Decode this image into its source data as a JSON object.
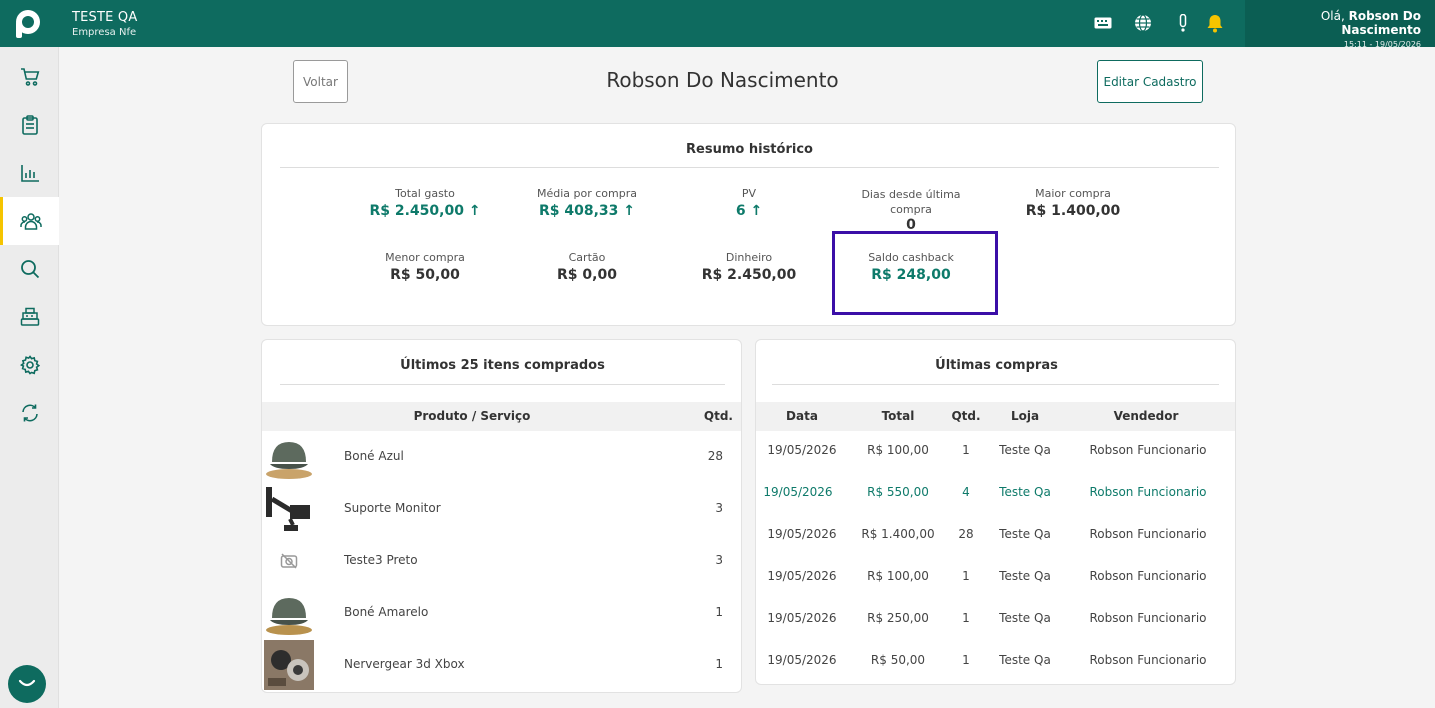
{
  "header": {
    "company_name": "TESTE QA",
    "company_sub": "Empresa Nfe",
    "greeting_prefix": "Olá,",
    "user_name": "Robson Do Nascimento",
    "datetime": "15:11 - 19/05/2026"
  },
  "actions": {
    "back_label": "Voltar",
    "title": "Robson Do Nascimento",
    "edit_label": "Editar Cadastro"
  },
  "resumo": {
    "title": "Resumo histórico",
    "stats": [
      {
        "label": "Total gasto",
        "value": "R$ 2.450,00"
      },
      {
        "label": "Média por compra",
        "value": "R$ 408,33"
      },
      {
        "label": "PV",
        "value": "6"
      },
      {
        "label": "Dias desde última compra",
        "value": "0"
      },
      {
        "label": "Maior compra",
        "value": "R$ 1.400,00"
      },
      {
        "label": "Menor compra",
        "value": "R$ 50,00"
      },
      {
        "label": "Cartão",
        "value": "R$ 0,00"
      },
      {
        "label": "Dinheiro",
        "value": "R$ 2.450,00"
      },
      {
        "label": "Saldo cashback",
        "value": "R$ 248,00"
      }
    ]
  },
  "itens": {
    "title": "Últimos 25 itens comprados",
    "col_product": "Produto / Serviço",
    "col_qty": "Qtd.",
    "rows": [
      {
        "name": "Boné Azul",
        "qty": "28"
      },
      {
        "name": "Suporte Monitor",
        "qty": "3"
      },
      {
        "name": "Teste3 Preto",
        "qty": "3"
      },
      {
        "name": "Boné Amarelo",
        "qty": "1"
      },
      {
        "name": "Nervergear 3d Xbox",
        "qty": "1"
      }
    ]
  },
  "compras": {
    "title": "Últimas compras",
    "columns": [
      "Data",
      "Total",
      "Qtd.",
      "Loja",
      "Vendedor"
    ],
    "rows": [
      [
        "19/05/2026",
        "R$ 100,00",
        "1",
        "Teste Qa",
        "Robson Funcionario"
      ],
      [
        "19/05/2026",
        "R$ 550,00",
        "4",
        "Teste Qa",
        "Robson Funcionario"
      ],
      [
        "19/05/2026",
        "R$ 1.400,00",
        "28",
        "Teste Qa",
        "Robson Funcionario"
      ],
      [
        "19/05/2026",
        "R$ 100,00",
        "1",
        "Teste Qa",
        "Robson Funcionario"
      ],
      [
        "19/05/2026",
        "R$ 250,00",
        "1",
        "Teste Qa",
        "Robson Funcionario"
      ],
      [
        "19/05/2026",
        "R$ 50,00",
        "1",
        "Teste Qa",
        "Robson Funcionario"
      ]
    ]
  },
  "colors": {
    "brand": "#0e6b5f",
    "accent": "#0e7a6a",
    "highlight": "#3b0ea7",
    "active_marker": "#f5c400"
  }
}
